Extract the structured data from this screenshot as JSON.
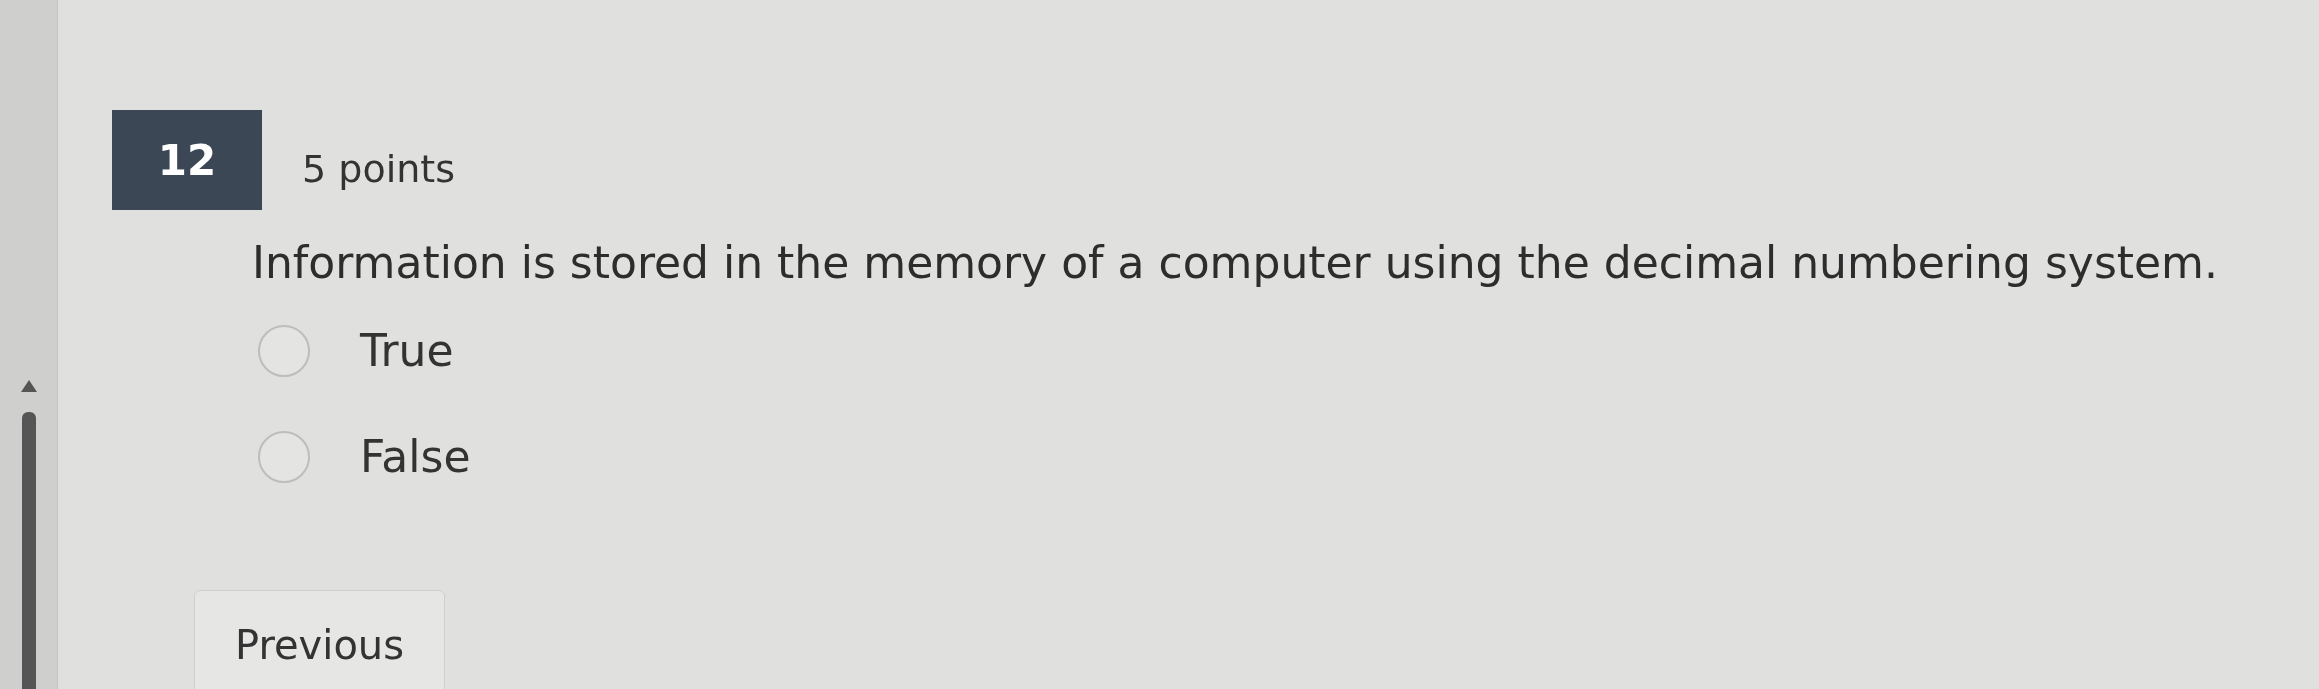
{
  "question": {
    "number": "12",
    "points": "5 points",
    "text": "Information is stored in the memory of a computer using the decimal numbering system.",
    "options": [
      {
        "label": "True",
        "selected": false
      },
      {
        "label": "False",
        "selected": false
      }
    ]
  },
  "buttons": [
    "Previous"
  ]
}
